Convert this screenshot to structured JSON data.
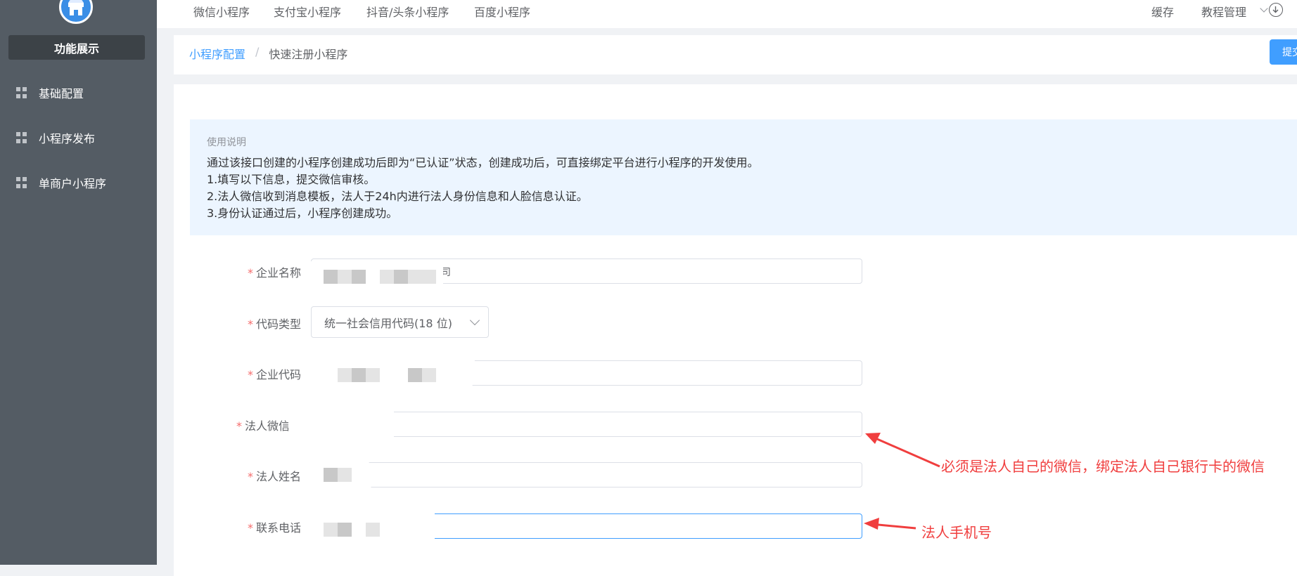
{
  "sidebar": {
    "brand": "功能展示",
    "items": [
      {
        "label": "基础配置"
      },
      {
        "label": "小程序发布"
      },
      {
        "label": "单商户小程序"
      }
    ],
    "icon": "store-icon"
  },
  "topnav": {
    "tabs": [
      "微信小程序",
      "支付宝小程序",
      "抖音/头条小程序",
      "百度小程序"
    ],
    "cache": "缓存",
    "manage": "教程管理"
  },
  "breadcrumb": {
    "root": "小程序配置",
    "separator": "/",
    "current": "快速注册小程序"
  },
  "submit_label": "提交",
  "notice": {
    "title": "使用说明",
    "lines": [
      "通过该接口创建的小程序创建成功后即为“已认证”状态，创建成功后，可直接绑定平台进行小程序的开发使用。",
      "1.填写以下信息，提交微信审核。",
      "2.法人微信收到消息模板，法人于24h内进行法人身份信息和人脸信息认证。",
      "3.身份认证通过后，小程序创建成功。"
    ]
  },
  "form": {
    "company_name": {
      "label": "企业名称",
      "value_tail": "司"
    },
    "code_type": {
      "label": "代码类型",
      "value": "统一社会信用代码(18 位)"
    },
    "company_code": {
      "label": "企业代码"
    },
    "legal_wechat": {
      "label": "法人微信"
    },
    "legal_name": {
      "label": "法人姓名"
    },
    "phone": {
      "label": "联系电话"
    },
    "required_mark": "*"
  },
  "annotations": {
    "wechat_note": "必须是法人自己的微信，绑定法人自己银行卡的微信",
    "phone_note": "法人手机号"
  },
  "colors": {
    "sidebar_bg": "#545c64",
    "primary": "#409eff",
    "annotation_red": "#f03e3e"
  }
}
